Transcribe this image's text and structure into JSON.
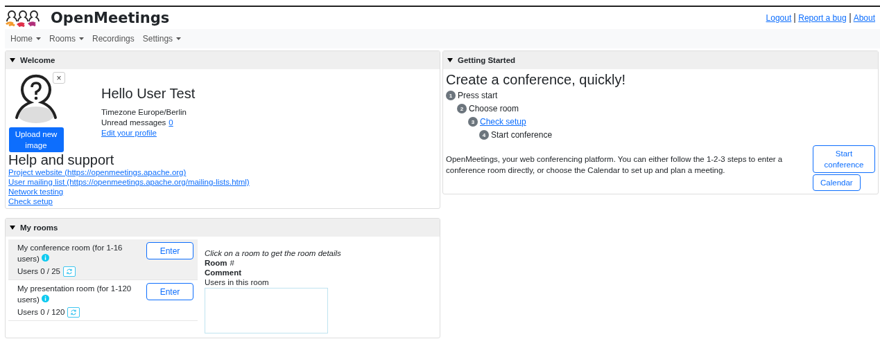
{
  "header": {
    "title": "OpenMeetings",
    "links": [
      "Logout",
      "Report a bug",
      "About"
    ]
  },
  "menu": [
    {
      "label": "Home",
      "dropdown": true
    },
    {
      "label": "Rooms",
      "dropdown": true
    },
    {
      "label": "Recordings",
      "dropdown": false
    },
    {
      "label": "Settings",
      "dropdown": true
    }
  ],
  "welcome": {
    "title": "Welcome",
    "expanded": true,
    "upload_button": "Upload new image",
    "close": "×",
    "greeting": "Hello User Test",
    "timezone": "Timezone Europe/Berlin",
    "unread_label": "Unread messages",
    "unread_count": "0",
    "edit_profile": "Edit your profile",
    "help_title": "Help and support",
    "help_links": [
      "Project website (https://openmeetings.apache.org)",
      "User mailing list (https://openmeetings.apache.org/mailing-lists.html)",
      "Network testing",
      "Check setup"
    ]
  },
  "my_rooms": {
    "title": "My rooms",
    "expanded": true,
    "rooms": [
      {
        "name": "My conference room (for 1-16 users)",
        "users": "Users 0 / 25",
        "button": "Enter",
        "selected": true
      },
      {
        "name": "My presentation room (for 1-120 users)",
        "users": "Users 0 / 120",
        "button": "Enter",
        "selected": false
      }
    ],
    "details": {
      "hint": "Click on a room to get the room details",
      "room_label": "Room",
      "room_value": "#",
      "comment_label": "Comment",
      "users_label": "Users in this room"
    }
  },
  "getting_started": {
    "title": "Getting Started",
    "expanded": true,
    "heading": "Create a conference, quickly!",
    "steps": [
      {
        "number": "1",
        "label": "Press start",
        "kind": "text"
      },
      {
        "number": "2",
        "label": "Choose room",
        "kind": "text"
      },
      {
        "number": "3",
        "label": "Check setup",
        "kind": "link"
      },
      {
        "number": "4",
        "label": "Start conference",
        "kind": "text"
      }
    ],
    "description": "OpenMeetings, your web conferencing platform. You can either follow the 1-2-3 steps to enter a conference room directly, or choose the Calendar to set up and plan a meeting.",
    "buttons": [
      "Start conference",
      "Calendar"
    ]
  }
}
